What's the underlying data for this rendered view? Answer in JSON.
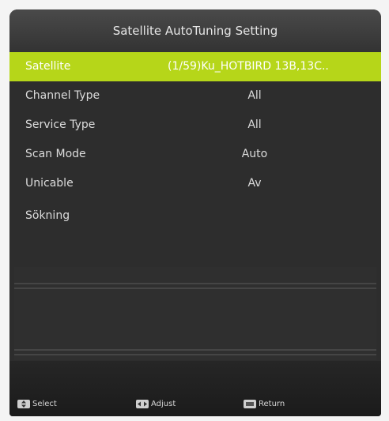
{
  "title": "Satellite AutoTuning Setting",
  "rows": [
    {
      "label": "Satellite",
      "value": "(1/59)Ku_HOTBIRD 13B,13C..",
      "selected": true
    },
    {
      "label": "Channel Type",
      "value": "All"
    },
    {
      "label": "Service Type",
      "value": "All"
    },
    {
      "label": "Scan Mode",
      "value": "Auto"
    },
    {
      "label": "Unicable",
      "value": "Av"
    }
  ],
  "search_label": "Sökning",
  "footer": {
    "select": "Select",
    "adjust": "Adjust",
    "return": "Return"
  },
  "colors": {
    "highlight": "#b6d619",
    "panel": "#2d2d2d"
  }
}
